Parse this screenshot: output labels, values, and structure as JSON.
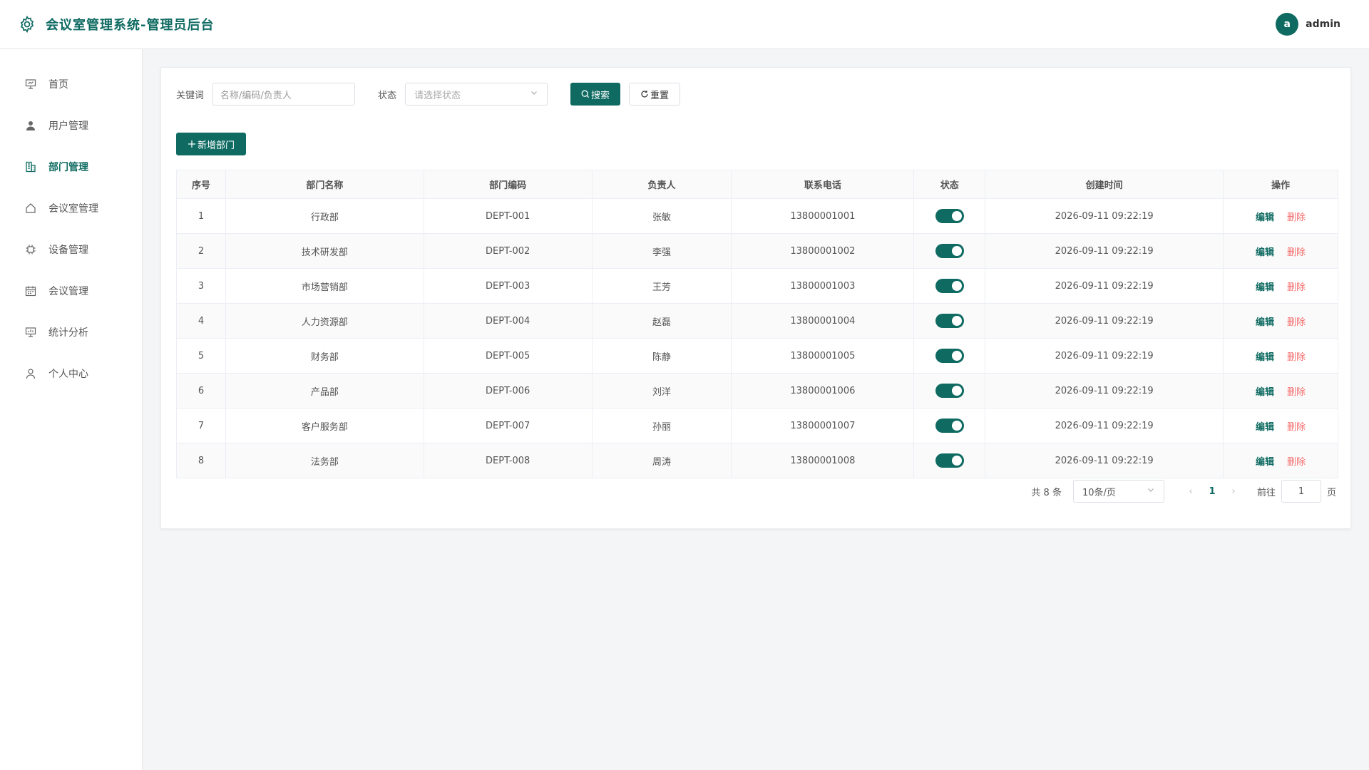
{
  "header": {
    "title": "会议室管理系统-管理员后台",
    "avatar_letter": "a",
    "username": "admin"
  },
  "sidebar": {
    "items": [
      {
        "label": "首页",
        "icon": "presentation-icon",
        "active": false
      },
      {
        "label": "用户管理",
        "icon": "user-icon",
        "active": false
      },
      {
        "label": "部门管理",
        "icon": "building-icon",
        "active": true
      },
      {
        "label": "会议室管理",
        "icon": "home-icon",
        "active": false
      },
      {
        "label": "设备管理",
        "icon": "chip-icon",
        "active": false
      },
      {
        "label": "会议管理",
        "icon": "calendar-icon",
        "active": false
      },
      {
        "label": "统计分析",
        "icon": "chart-board-icon",
        "active": false
      },
      {
        "label": "个人中心",
        "icon": "person-icon",
        "active": false
      }
    ]
  },
  "filter": {
    "keyword_label": "关键词",
    "keyword_placeholder": "名称/编码/负责人",
    "status_label": "状态",
    "status_placeholder": "请选择状态",
    "search_label": "搜索",
    "reset_label": "重置"
  },
  "add_button": "新增部门",
  "table": {
    "columns": [
      "序号",
      "部门名称",
      "部门编码",
      "负责人",
      "联系电话",
      "状态",
      "创建时间",
      "操作"
    ],
    "edit_label": "编辑",
    "delete_label": "删除",
    "rows": [
      {
        "no": "1",
        "name": "行政部",
        "code": "DEPT-001",
        "manager": "张敏",
        "phone": "13800001001",
        "enabled": true,
        "created": "2026-09-11 09:22:19"
      },
      {
        "no": "2",
        "name": "技术研发部",
        "code": "DEPT-002",
        "manager": "李强",
        "phone": "13800001002",
        "enabled": true,
        "created": "2026-09-11 09:22:19"
      },
      {
        "no": "3",
        "name": "市场营销部",
        "code": "DEPT-003",
        "manager": "王芳",
        "phone": "13800001003",
        "enabled": true,
        "created": "2026-09-11 09:22:19"
      },
      {
        "no": "4",
        "name": "人力资源部",
        "code": "DEPT-004",
        "manager": "赵磊",
        "phone": "13800001004",
        "enabled": true,
        "created": "2026-09-11 09:22:19"
      },
      {
        "no": "5",
        "name": "财务部",
        "code": "DEPT-005",
        "manager": "陈静",
        "phone": "13800001005",
        "enabled": true,
        "created": "2026-09-11 09:22:19"
      },
      {
        "no": "6",
        "name": "产品部",
        "code": "DEPT-006",
        "manager": "刘洋",
        "phone": "13800001006",
        "enabled": true,
        "created": "2026-09-11 09:22:19"
      },
      {
        "no": "7",
        "name": "客户服务部",
        "code": "DEPT-007",
        "manager": "孙丽",
        "phone": "13800001007",
        "enabled": true,
        "created": "2026-09-11 09:22:19"
      },
      {
        "no": "8",
        "name": "法务部",
        "code": "DEPT-008",
        "manager": "周涛",
        "phone": "13800001008",
        "enabled": true,
        "created": "2026-09-11 09:22:19"
      }
    ]
  },
  "pagination": {
    "total_text": "共 8 条",
    "page_size": "10条/页",
    "current_page": "1",
    "goto_label": "前往",
    "goto_value": "1",
    "page_suffix": "页"
  },
  "colors": {
    "primary": "#0f6b62",
    "danger": "#f56c6c"
  }
}
